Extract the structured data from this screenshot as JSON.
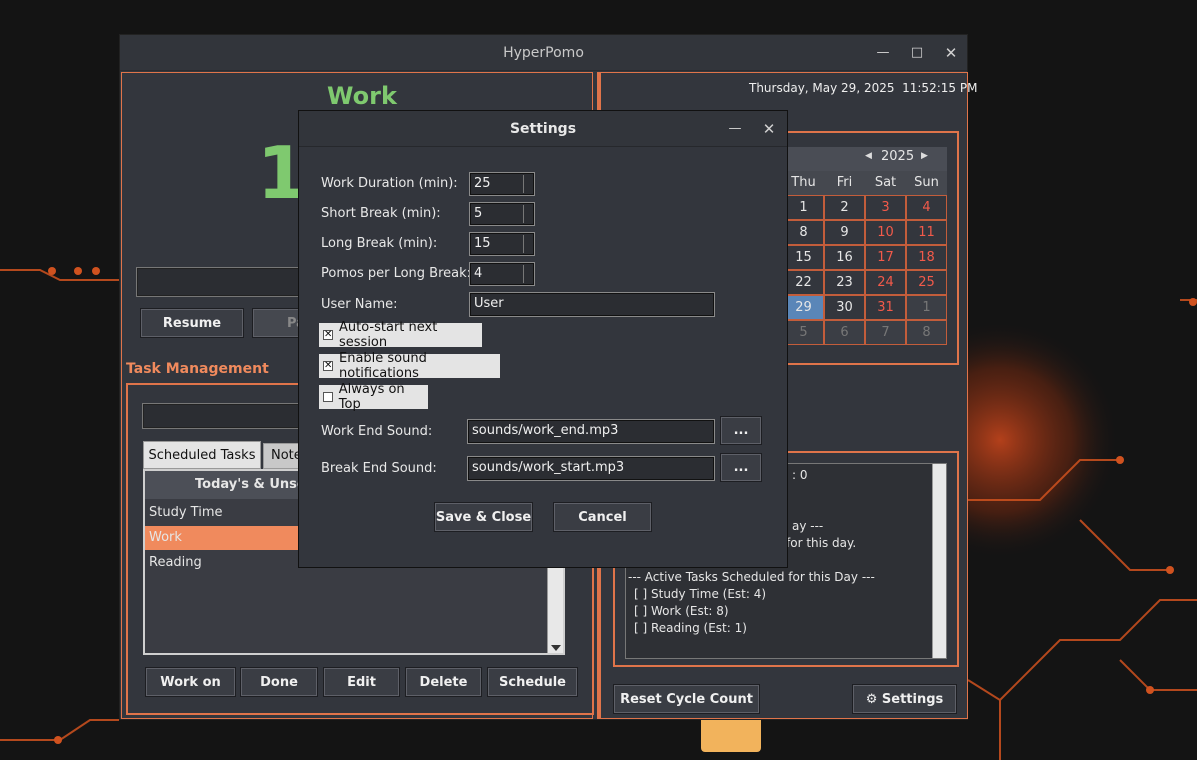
{
  "window": {
    "title": "HyperPomo"
  },
  "timer": {
    "mode": "Work",
    "time_partial": "1"
  },
  "controls": {
    "resume": "Resume",
    "pause_partial": "Pa"
  },
  "tasks": {
    "heading": "Task Management",
    "tabs": [
      "Scheduled Tasks",
      "Note"
    ],
    "list_header": "Today's & Unsche",
    "items": [
      "Study Time",
      "Work",
      "Reading"
    ],
    "selected_index": 1,
    "buttons": {
      "work_on": "Work on",
      "done": "Done",
      "edit": "Edit",
      "delete": "Delete",
      "schedule": "Schedule"
    }
  },
  "right": {
    "datetime": "Thursday, May 29, 2025  11:52:15 PM",
    "calendar": {
      "year": "2025",
      "weekdays": [
        "Thu",
        "Fri",
        "Sat",
        "Sun"
      ],
      "rows": [
        [
          "1",
          "2",
          "3",
          "4"
        ],
        [
          "8",
          "9",
          "10",
          "11"
        ],
        [
          "15",
          "16",
          "17",
          "18"
        ],
        [
          "22",
          "23",
          "24",
          "25"
        ],
        [
          "29",
          "30",
          "31",
          "1"
        ],
        [
          "5",
          "6",
          "7",
          "8"
        ]
      ]
    },
    "log_partial": {
      "count": ": 0",
      "line_day": "ay ---",
      "line_for": "for this day."
    },
    "log": {
      "active_heading": "--- Active Tasks Scheduled for this Day ---",
      "items": [
        "[ ] Study Time (Est: 4)",
        "[ ] Work (Est: 8)",
        "[ ] Reading (Est: 1)"
      ]
    },
    "reset_button": "Reset Cycle Count",
    "settings_button": "⚙ Settings"
  },
  "settings": {
    "title": "Settings",
    "work_duration": {
      "label": "Work Duration (min):",
      "value": "25"
    },
    "short_break": {
      "label": "Short Break (min):",
      "value": "5"
    },
    "long_break": {
      "label": "Long Break (min):",
      "value": "15"
    },
    "pomos_per_long": {
      "label": "Pomos per Long Break:",
      "value": "4"
    },
    "user_name": {
      "label": "User Name:",
      "value": "User"
    },
    "auto_start": {
      "label": "Auto-start next session",
      "checked": true
    },
    "sound_notify": {
      "label": "Enable sound notifications",
      "checked": true
    },
    "always_on_top": {
      "label": "Always on Top",
      "checked": false
    },
    "work_end_sound": {
      "label": "Work End Sound:",
      "value": "sounds/work_end.mp3"
    },
    "break_end_sound": {
      "label": "Break End Sound:",
      "value": "sounds/work_start.mp3"
    },
    "browse_label": "...",
    "save_button": "Save & Close",
    "cancel_button": "Cancel"
  },
  "colors": {
    "accent": "#e0744a",
    "work_green": "#7fc96f",
    "selected_row": "#f08a5d",
    "background": "#141414",
    "panel": "#33363d"
  }
}
